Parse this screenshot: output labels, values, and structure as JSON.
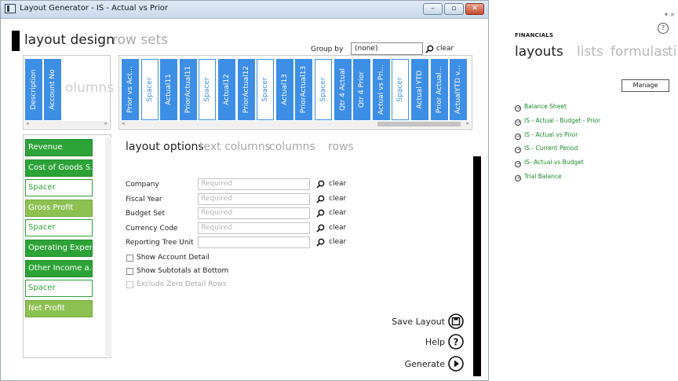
{
  "window": {
    "title": "Layout Generator - IS - Actual vs Prior",
    "controls": {
      "minimize": "–",
      "restore": "▫",
      "close": "✕"
    }
  },
  "header": {
    "tab_active": "layout design",
    "tab_inactive": "row sets"
  },
  "group_by": {
    "label": "Group by",
    "value": "(none)",
    "clear": "clear"
  },
  "row_columns": {
    "ghost": "olumns",
    "tiles": [
      "Description",
      "Account No"
    ]
  },
  "columns": [
    {
      "label": "Prior vs Act...",
      "style": "blue"
    },
    {
      "label": "Spacer",
      "style": "outline"
    },
    {
      "label": "Actual11",
      "style": "blue"
    },
    {
      "label": "PriorActual11",
      "style": "blue"
    },
    {
      "label": "Spacer",
      "style": "outline"
    },
    {
      "label": "Actual12",
      "style": "blue"
    },
    {
      "label": "PriorActual12",
      "style": "blue"
    },
    {
      "label": "Spacer",
      "style": "outline"
    },
    {
      "label": "Actual13",
      "style": "blue"
    },
    {
      "label": "PriorActual13",
      "style": "blue"
    },
    {
      "label": "Spacer",
      "style": "outline"
    },
    {
      "label": "Qtr 4 Actual",
      "style": "blue"
    },
    {
      "label": "Qtr 4 Prior",
      "style": "blue"
    },
    {
      "label": "Actual vs Pri...",
      "style": "blue"
    },
    {
      "label": "Spacer",
      "style": "outline"
    },
    {
      "label": "Actual YTD",
      "style": "blue"
    },
    {
      "label": "Prior Actual...",
      "style": "blue"
    },
    {
      "label": "ActualYTD v...",
      "style": "blue"
    }
  ],
  "rows": [
    {
      "label": "Revenue",
      "style": "dark"
    },
    {
      "label": "Cost of Goods S...",
      "style": "dark"
    },
    {
      "label": "Spacer",
      "style": "outline"
    },
    {
      "label": "Gross Profit",
      "style": "light"
    },
    {
      "label": "Spacer",
      "style": "outline"
    },
    {
      "label": "Operating Expen...",
      "style": "dark"
    },
    {
      "label": "Other Income a...",
      "style": "dark"
    },
    {
      "label": "Spacer",
      "style": "outline"
    },
    {
      "label": "Net Profit",
      "style": "light"
    }
  ],
  "options_tabs": {
    "active": "layout options",
    "t2": "text columns",
    "t3": "columns",
    "t4": "rows"
  },
  "fields": [
    {
      "label": "Company",
      "placeholder": "Required",
      "clear": "clear"
    },
    {
      "label": "Fiscal Year",
      "placeholder": "Required",
      "clear": "clear"
    },
    {
      "label": "Budget Set",
      "placeholder": "Required",
      "clear": "clear"
    },
    {
      "label": "Currency Code",
      "placeholder": "Required",
      "clear": "clear"
    },
    {
      "label": "Reporting Tree Unit",
      "placeholder": "",
      "clear": "clear"
    }
  ],
  "checkboxes": [
    {
      "label": "Show Account Detail",
      "disabled": false
    },
    {
      "label": "Show Subtotals at Bottom",
      "disabled": false
    },
    {
      "label": "Exclude Zero Detail Rows",
      "disabled": true
    }
  ],
  "actions": {
    "save": "Save Layout",
    "help": "Help",
    "generate": "Generate"
  },
  "financials": {
    "title": "FINANCIALS",
    "help_glyph": "?",
    "window_controls": "▾ ×",
    "tabs": {
      "active": "layouts",
      "t2": "lists",
      "t3": "formulas",
      "t4": "ti..."
    },
    "manage": "Manage",
    "links": [
      "Balance Sheet",
      "IS - Actual - Budget - Prior",
      "IS - Actual vs Prior",
      "IS - Current Period",
      "IS- Actual vs Budget",
      "Trial Balance"
    ]
  },
  "colors": {
    "blue": "#3d8ee5",
    "green_dark": "#2da337",
    "green_light": "#8cc152",
    "link_green": "#1e8a2e"
  }
}
